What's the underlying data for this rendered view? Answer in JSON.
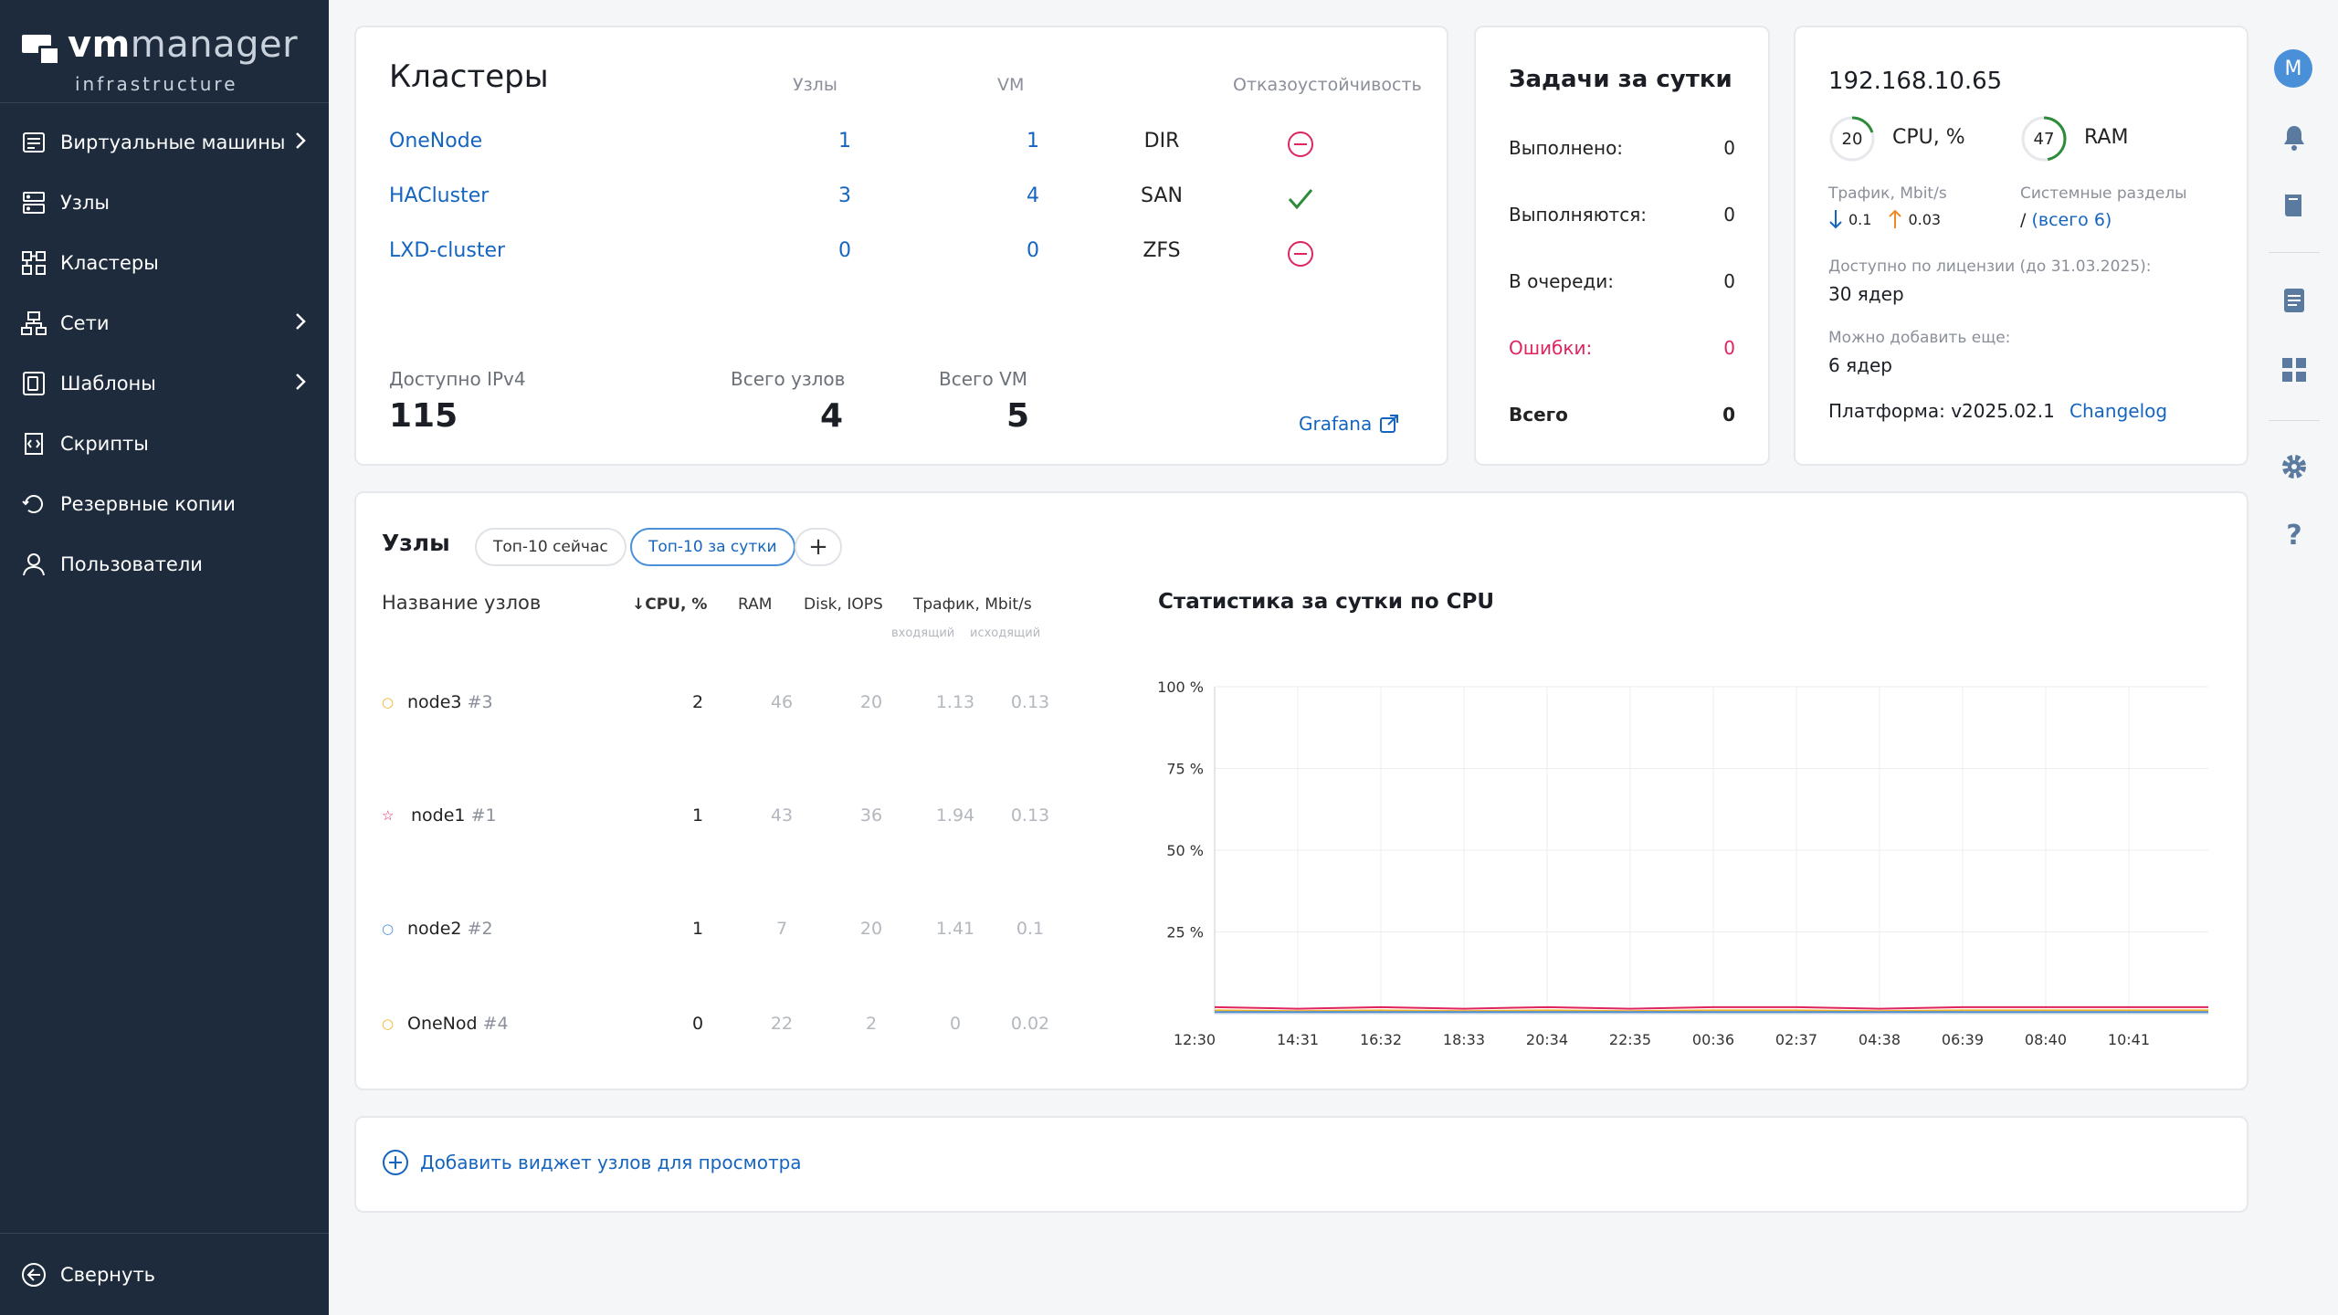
{
  "app": {
    "logo_vm": "vm",
    "logo_manager": "manager",
    "logo_sub": "infrastructure",
    "user_initial": "M"
  },
  "sidebar": {
    "items": [
      {
        "label": "Виртуальные машины",
        "icon": "vm-icon",
        "has_arrow": true
      },
      {
        "label": "Узлы",
        "icon": "nodes-icon",
        "has_arrow": false
      },
      {
        "label": "Кластеры",
        "icon": "clusters-icon",
        "has_arrow": false
      },
      {
        "label": "Сети",
        "icon": "network-icon",
        "has_arrow": true
      },
      {
        "label": "Шаблоны",
        "icon": "templates-icon",
        "has_arrow": true
      },
      {
        "label": "Скрипты",
        "icon": "scripts-icon",
        "has_arrow": false
      },
      {
        "label": "Резервные копии",
        "icon": "backup-icon",
        "has_arrow": false
      },
      {
        "label": "Пользователи",
        "icon": "users-icon",
        "has_arrow": false
      }
    ],
    "collapse_label": "Свернуть"
  },
  "clusters": {
    "title": "Кластеры",
    "col_nodes": "Узлы",
    "col_vm": "VM",
    "col_ha": "Отказоустойчивость",
    "rows": [
      {
        "name": "OneNode",
        "nodes": "1",
        "vm": "1",
        "storage": "DIR",
        "ha": false
      },
      {
        "name": "HACluster",
        "nodes": "3",
        "vm": "4",
        "storage": "SAN",
        "ha": true
      },
      {
        "name": "LXD-cluster",
        "nodes": "0",
        "vm": "0",
        "storage": "ZFS",
        "ha": false
      }
    ],
    "ipv4_label": "Доступно IPv4",
    "ipv4_value": "115",
    "total_nodes_label": "Всего узлов",
    "total_nodes_value": "4",
    "total_vm_label": "Всего VM",
    "total_vm_value": "5",
    "grafana_label": "Grafana"
  },
  "tasks": {
    "title": "Задачи за сутки",
    "rows": [
      {
        "label": "Выполнено:",
        "value": "0"
      },
      {
        "label": "Выполняются:",
        "value": "0"
      },
      {
        "label": "В очереди:",
        "value": "0"
      },
      {
        "label": "Ошибки:",
        "value": "0"
      },
      {
        "label": "Всего",
        "value": "0"
      }
    ]
  },
  "node_info": {
    "ip": "192.168.10.65",
    "cpu_value": "20",
    "cpu_percent": 20,
    "cpu_label": "CPU, %",
    "ram_value": "47",
    "ram_percent": 47,
    "ram_label": "RAM",
    "traffic_label": "Трафик, Mbit/s",
    "traffic_in": "0.1",
    "traffic_out": "0.03",
    "partitions_label": "Системные разделы",
    "partitions_prefix": "/",
    "partitions_link": "(всего 6)",
    "license_label": "Доступно по лицензии (до 31.03.2025):",
    "license_value": "30 ядер",
    "can_add_label": "Можно добавить еще:",
    "can_add_value": "6 ядер",
    "platform_label": "Платформа: v2025.02.1",
    "changelog_label": "Changelog"
  },
  "nodes_widget": {
    "title": "Узлы",
    "tab_now": "Топ-10 сейчас",
    "tab_day": "Топ-10 за сутки",
    "add_symbol": "+",
    "col_name": "Название узлов",
    "col_cpu": "↓CPU, %",
    "col_ram": "RAM",
    "col_disk": "Disk, IOPS",
    "col_traffic": "Трафик, Mbit/s",
    "col_in": "входящий",
    "col_out": "исходящий",
    "rows": [
      {
        "mark": "○",
        "mark_color": "#f0b429",
        "name": "node3",
        "id": "#3",
        "cpu": "2",
        "ram": "46",
        "disk": "20",
        "in": "1.13",
        "out": "0.13"
      },
      {
        "mark": "☆",
        "mark_color": "#e0245e",
        "name": "node1",
        "id": "#1",
        "cpu": "1",
        "ram": "43",
        "disk": "36",
        "in": "1.94",
        "out": "0.13"
      },
      {
        "mark": "○",
        "mark_color": "#4a90d9",
        "name": "node2",
        "id": "#2",
        "cpu": "1",
        "ram": "7",
        "disk": "20",
        "in": "1.41",
        "out": "0.1"
      },
      {
        "mark": "○",
        "mark_color": "#f0b429",
        "name": "OneNod",
        "id": "#4",
        "cpu": "0",
        "ram": "22",
        "disk": "2",
        "in": "0",
        "out": "0.02"
      }
    ],
    "chart_title": "Статистика за сутки по CPU"
  },
  "chart_data": {
    "type": "line",
    "title": "Статистика за сутки по CPU",
    "x": [
      "12:30",
      "14:31",
      "16:32",
      "18:33",
      "20:34",
      "22:35",
      "00:36",
      "02:37",
      "04:38",
      "06:39",
      "08:40",
      "10:41"
    ],
    "y_ticks": [
      "100 %",
      "75 %",
      "50 %",
      "25 %"
    ],
    "ylim": [
      0,
      100
    ],
    "grid": true,
    "series": [
      {
        "color": "#e0245e",
        "values": [
          2,
          1.5,
          2,
          1.5,
          2,
          1.5,
          2,
          2,
          1.5,
          2,
          2,
          2
        ]
      },
      {
        "color": "#f0b429",
        "values": [
          1,
          0.8,
          1,
          0.8,
          1,
          0.8,
          1,
          1,
          0.8,
          1,
          1,
          1
        ]
      },
      {
        "color": "#4a90d9",
        "values": [
          0.5,
          0.5,
          0.5,
          0.5,
          0.5,
          0.5,
          0.5,
          0.5,
          0.5,
          0.5,
          0.5,
          0.5
        ]
      }
    ]
  },
  "add_widget": {
    "label": "Добавить виджет узлов для просмотра"
  }
}
